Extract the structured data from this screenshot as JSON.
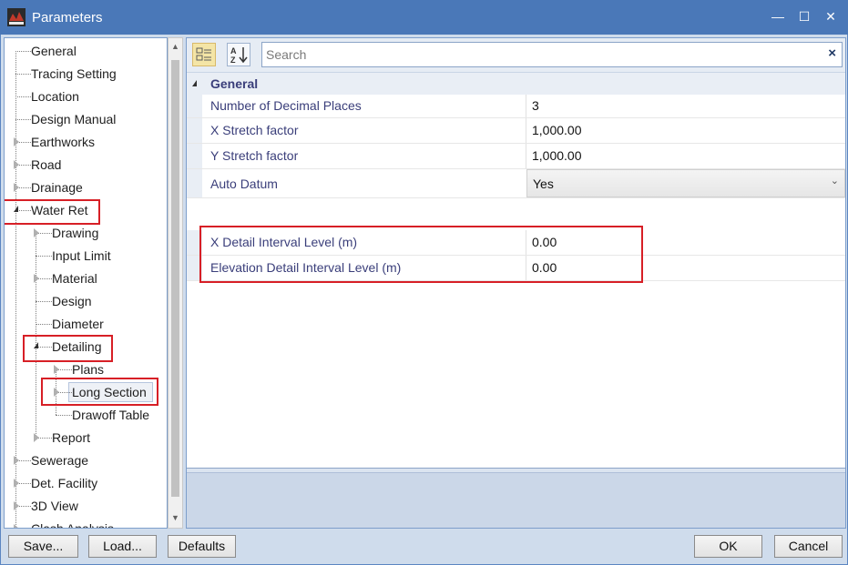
{
  "window": {
    "title": "Parameters",
    "controls": {
      "minimize": "—",
      "maximize": "☐",
      "close": "✕"
    },
    "icon": "app-logo-icon"
  },
  "tree": {
    "items": [
      {
        "label": "General",
        "level": 0,
        "expander": "none"
      },
      {
        "label": "Tracing Setting",
        "level": 0,
        "expander": "none"
      },
      {
        "label": "Location",
        "level": 0,
        "expander": "none"
      },
      {
        "label": "Design Manual",
        "level": 0,
        "expander": "none"
      },
      {
        "label": "Earthworks",
        "level": 0,
        "expander": "collapsed"
      },
      {
        "label": "Road",
        "level": 0,
        "expander": "collapsed"
      },
      {
        "label": "Drainage",
        "level": 0,
        "expander": "collapsed"
      },
      {
        "label": "Water Ret",
        "level": 0,
        "expander": "expanded"
      },
      {
        "label": "Drawing",
        "level": 1,
        "expander": "collapsed"
      },
      {
        "label": "Input Limit",
        "level": 1,
        "expander": "none"
      },
      {
        "label": "Material",
        "level": 1,
        "expander": "collapsed"
      },
      {
        "label": "Design",
        "level": 1,
        "expander": "none"
      },
      {
        "label": "Diameter",
        "level": 1,
        "expander": "none"
      },
      {
        "label": "Detailing",
        "level": 1,
        "expander": "expanded"
      },
      {
        "label": "Plans",
        "level": 2,
        "expander": "collapsed"
      },
      {
        "label": "Long Section",
        "level": 2,
        "expander": "collapsed",
        "selected": true
      },
      {
        "label": "Drawoff Table",
        "level": 2,
        "expander": "none"
      },
      {
        "label": "Report",
        "level": 1,
        "expander": "collapsed"
      },
      {
        "label": "Sewerage",
        "level": 0,
        "expander": "collapsed"
      },
      {
        "label": "Det. Facility",
        "level": 0,
        "expander": "collapsed"
      },
      {
        "label": "3D View",
        "level": 0,
        "expander": "collapsed"
      },
      {
        "label": "Clash Analysis",
        "level": 0,
        "expander": "collapsed"
      }
    ]
  },
  "toolbar": {
    "categorized_icon": "categorized-view-icon",
    "alphabetical_icon": "sort-az-icon",
    "search_placeholder": "Search",
    "search_clear": "×"
  },
  "grid": {
    "category": "General",
    "properties": [
      {
        "name": "Number of Decimal Places",
        "value": "3"
      },
      {
        "name": "X Stretch factor",
        "value": "1,000.00"
      },
      {
        "name": "Y Stretch factor",
        "value": "1,000.00"
      },
      {
        "name": "Auto Datum",
        "value": "Yes",
        "type": "select"
      },
      {
        "name": "X Detail Interval Level (m)",
        "value": "0.00"
      },
      {
        "name": "Elevation Detail Interval Level (m)",
        "value": "0.00"
      }
    ]
  },
  "buttons": {
    "save": "Save...",
    "load": "Load...",
    "defaults": "Defaults",
    "ok": "OK",
    "cancel": "Cancel"
  },
  "colors": {
    "titlebar": "#4a78b8",
    "highlight_box": "#d71f26",
    "property_name": "#3a3e7a"
  }
}
